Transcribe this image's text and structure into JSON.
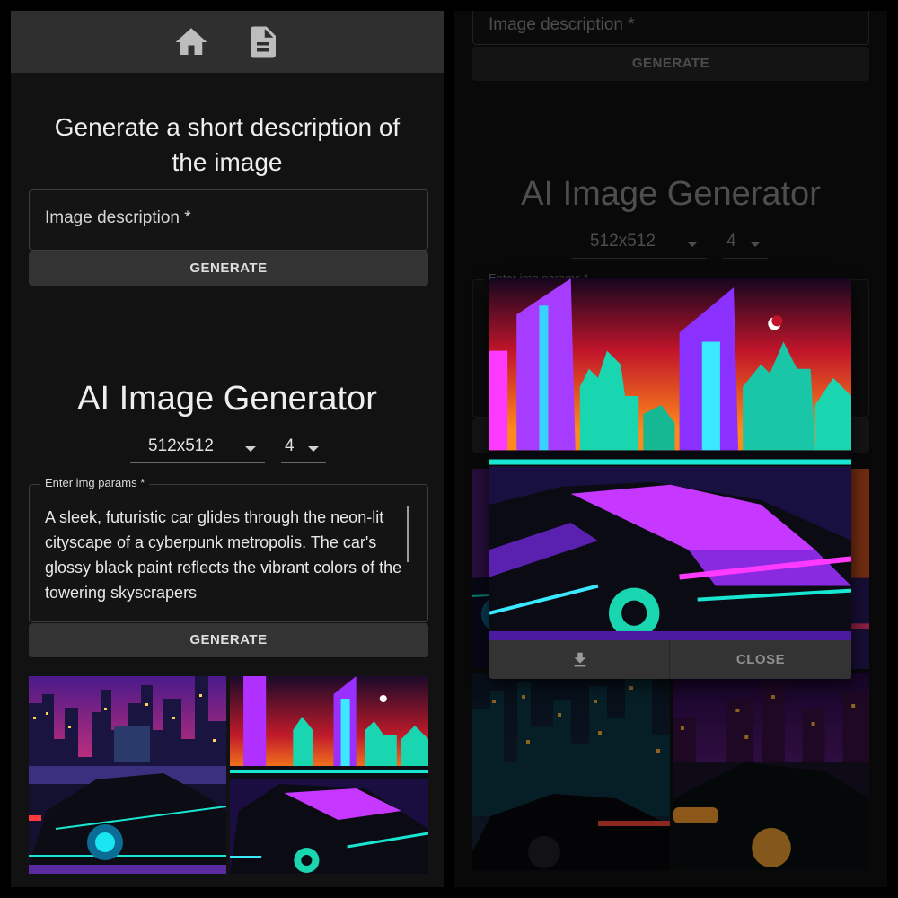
{
  "nav": {
    "home_icon": "home-icon",
    "doc_icon": "document-icon"
  },
  "describe": {
    "title": "Generate a short description of the image",
    "input_label": "Image description *",
    "button": "GENERATE"
  },
  "generator": {
    "title": "AI Image Generator",
    "size_value": "512x512",
    "count_value": "4",
    "params_label": "Enter img params *",
    "params_text": " A sleek, futuristic car glides through the neon-lit cityscape of a cyberpunk metropolis. The car's glossy black paint reflects the vibrant colors of the towering skyscrapers",
    "button": "GENERATE"
  },
  "right": {
    "describe_label": "Image description *",
    "describe_button": "GENERATE",
    "title": "AI Image Generator",
    "size_value": "512x512",
    "count_value": "4",
    "params_label": "Enter img params *"
  },
  "dialog": {
    "download_icon": "download-icon",
    "close_label": "CLOSE"
  },
  "colors": {
    "background": "#121212",
    "appbar": "#2f2f2f",
    "button": "#333333",
    "neon_magenta": "#c638ff",
    "neon_cyan": "#19e6d0"
  }
}
